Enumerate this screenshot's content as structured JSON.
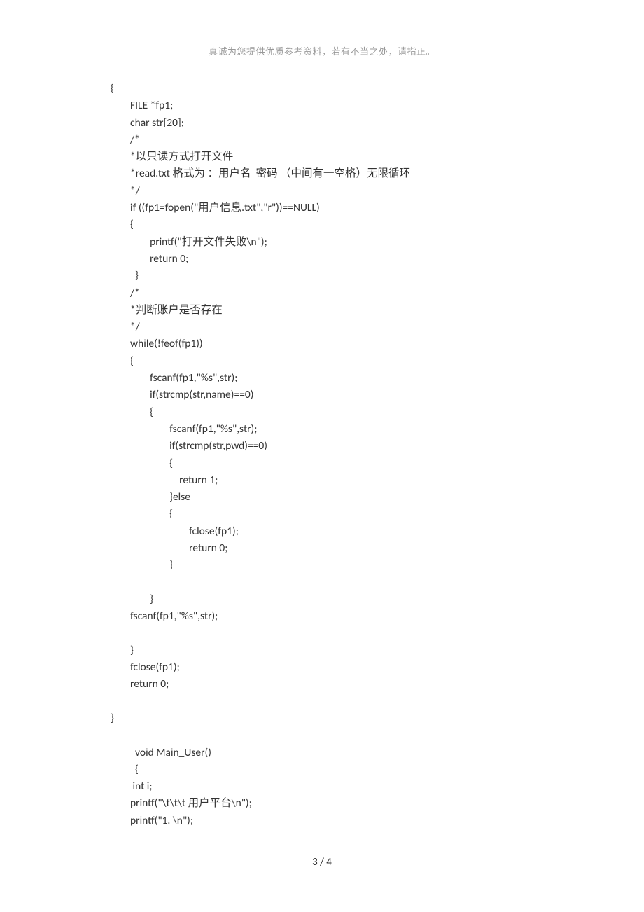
{
  "header": "真诚为您提供优质参考资料，若有不当之处，请指正。",
  "footer": "3  /  4",
  "code": "{\n        FILE *fp1;\n        char str[20];\n        /*\n        *以只读方式打开文件\n        *read.txt 格式为 ：用户名  密码 （中间有一空格）无限循环\n        */\n        if ((fp1=fopen(\"用户信息.txt\",\"r\"))==NULL)\n        {\n                printf(\"打开文件失败\\n\");\n                return 0;\n          }\n        /*\n        *判断账户是否存在\n        */\n        while(!feof(fp1))\n        {\n                fscanf(fp1,\"%s\",str);\n                if(strcmp(str,name)==0)\n                {\n                        fscanf(fp1,\"%s\",str);\n                        if(strcmp(str,pwd)==0)\n                        {\n                            return 1;\n                        }else\n                        {\n                                fclose(fp1);\n                                return 0;\n                        }\n\n                }\n        fscanf(fp1,\"%s\",str);\n\n        }\n        fclose(fp1);\n        return 0;\n\n}\n\n          void Main_User()\n          {\n         int i;\n        printf(\"\\t\\t\\t 用户平台\\n\");\n        printf(\"1. \\n\");"
}
